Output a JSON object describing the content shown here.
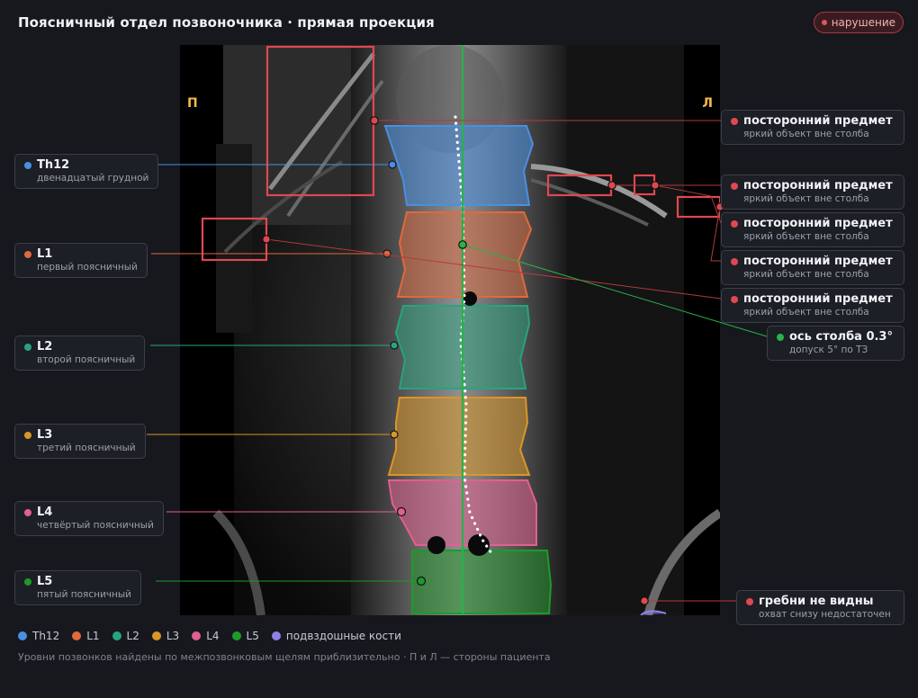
{
  "header": {
    "title": "Поясничный отдел позвоночника · прямая проекция",
    "status_badge": "нарушение"
  },
  "viewer": {
    "side_right_patient": "П",
    "side_left_patient": "Л"
  },
  "colors": {
    "th12": "#4a8fe2",
    "l1": "#e06a3c",
    "l2": "#29a37f",
    "l3": "#d9962a",
    "l4": "#e0608f",
    "l5": "#1e9a2a",
    "iliac": "#8c82e6",
    "alert": "#e0484f",
    "axis": "#27b34a"
  },
  "vertebrae": [
    {
      "id": "th12",
      "label": "Th12",
      "desc": "двенадцатый грудной",
      "color": "#4a8fe2"
    },
    {
      "id": "l1",
      "label": "L1",
      "desc": "первый поясничный",
      "color": "#e06a3c"
    },
    {
      "id": "l2",
      "label": "L2",
      "desc": "второй поясничный",
      "color": "#29a37f"
    },
    {
      "id": "l3",
      "label": "L3",
      "desc": "третий поясничный",
      "color": "#d9962a"
    },
    {
      "id": "l4",
      "label": "L4",
      "desc": "четвёртый поясничный",
      "color": "#e0608f"
    },
    {
      "id": "l5",
      "label": "L5",
      "desc": "пятый поясничный",
      "color": "#1e9a2a"
    }
  ],
  "findings": [
    {
      "title": "посторонний предмет",
      "desc": "яркий объект вне столба"
    },
    {
      "title": "посторонний предмет",
      "desc": "яркий объект вне столба"
    },
    {
      "title": "посторонний предмет",
      "desc": "яркий объект вне столба"
    },
    {
      "title": "посторонний предмет",
      "desc": "яркий объект вне столба"
    },
    {
      "title": "посторонний предмет",
      "desc": "яркий объект вне столба"
    }
  ],
  "axis": {
    "title": "ось столба 0.3°",
    "desc": "допуск 5° по ТЗ"
  },
  "crests": {
    "title": "гребни не видны",
    "desc": "охват снизу недостаточен"
  },
  "legend": [
    "Th12",
    "L1",
    "L2",
    "L3",
    "L4",
    "L5",
    "подвздошные кости"
  ],
  "footnote": "Уровни позвонков найдены по межпозвонковым щелям приблизительно · П и Л — стороны пациента"
}
